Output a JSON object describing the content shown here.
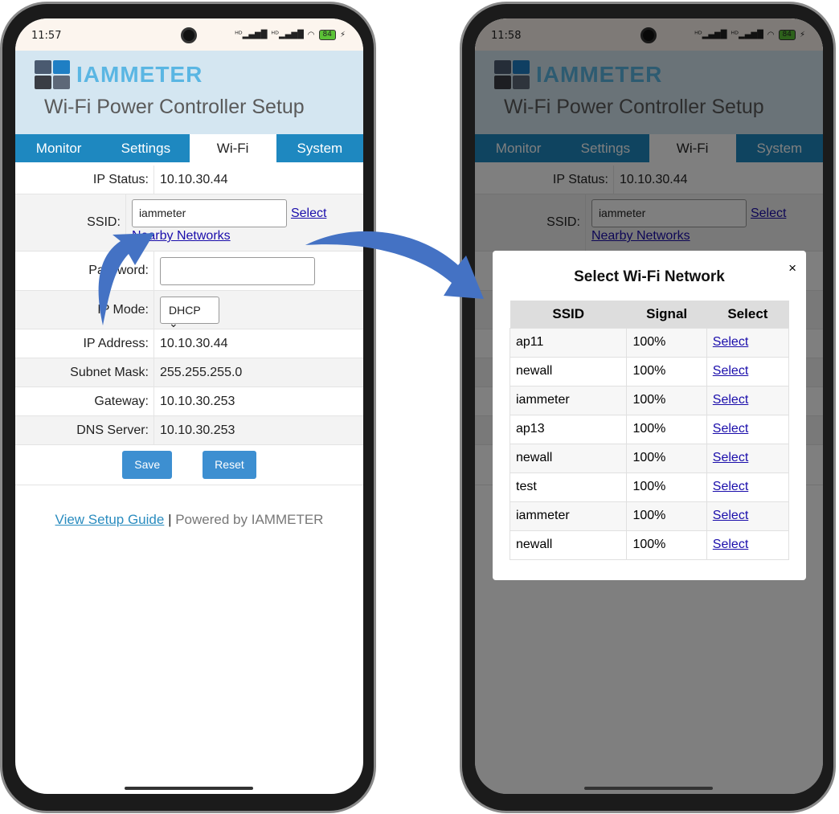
{
  "left_phone": {
    "status_time": "11:57"
  },
  "right_phone": {
    "status_time": "11:58"
  },
  "status_icons": {
    "signal1": "HD signal",
    "signal2": "HD signal",
    "wifi": "wifi-icon",
    "battery": "84",
    "charging": "⚡"
  },
  "header": {
    "logo_text": "IAMMETER",
    "title": "Wi-Fi Power Controller Setup"
  },
  "tabs": [
    {
      "label": "Monitor"
    },
    {
      "label": "Settings"
    },
    {
      "label": "Wi-Fi",
      "active": true
    },
    {
      "label": "System"
    }
  ],
  "form": {
    "ip_status_label": "IP Status:",
    "ip_status": "10.10.30.44",
    "ssid_label": "SSID:",
    "ssid_value": "iammeter",
    "select_link": "Select",
    "nearby_link": "Nearby Networks",
    "password_label": "Password:",
    "password_value": "",
    "ip_mode_label": "IP Mode:",
    "ip_mode": "DHCP",
    "ip_address_label": "IP Address:",
    "ip_address": "10.10.30.44",
    "subnet_label": "Subnet Mask:",
    "subnet": "255.255.255.0",
    "gateway_label": "Gateway:",
    "gateway": "10.10.30.253",
    "dns_label": "DNS Server:",
    "dns": "10.10.30.253",
    "save": "Save",
    "reset": "Reset"
  },
  "footer": {
    "guide_link": "View Setup Guide",
    "separator": "|",
    "powered": "Powered by IAMMETER"
  },
  "modal": {
    "title": "Select Wi-Fi Network",
    "close": "×",
    "columns": [
      "SSID",
      "Signal",
      "Select"
    ],
    "rows": [
      {
        "ssid": "ap11",
        "signal": "100%",
        "action": "Select"
      },
      {
        "ssid": "newall",
        "signal": "100%",
        "action": "Select"
      },
      {
        "ssid": "iammeter",
        "signal": "100%",
        "action": "Select"
      },
      {
        "ssid": "ap13",
        "signal": "100%",
        "action": "Select"
      },
      {
        "ssid": "newall",
        "signal": "100%",
        "action": "Select"
      },
      {
        "ssid": "test",
        "signal": "100%",
        "action": "Select"
      },
      {
        "ssid": "iammeter",
        "signal": "100%",
        "action": "Select"
      },
      {
        "ssid": "newall",
        "signal": "100%",
        "action": "Select"
      }
    ]
  },
  "colors": {
    "tab_bar": "#1e88c0",
    "header_bg": "#d4e6f1",
    "button": "#3d8fd1",
    "arrow": "#4472c4"
  }
}
